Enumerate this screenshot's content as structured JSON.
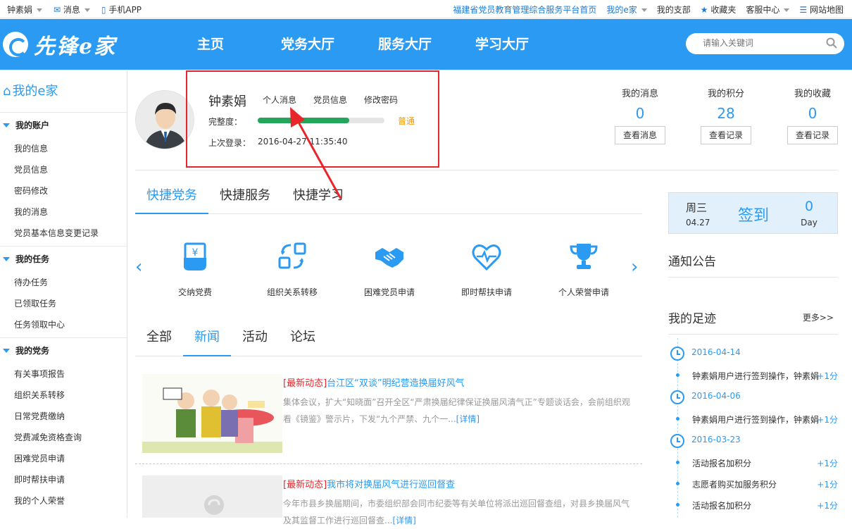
{
  "topbar": {
    "user": "钟素娟",
    "messages": "消息",
    "mobile_app": "手机APP",
    "portal_link": "福建省党员教育管理综合服务平台首页",
    "my_ejia": "我的e家",
    "my_branch": "我的支部",
    "favorites": "收藏夹",
    "service_center": "客服中心",
    "sitemap": "网站地图"
  },
  "header": {
    "logo_text": "先锋e家",
    "nav": [
      "主页",
      "党务大厅",
      "服务大厅",
      "学习大厅"
    ],
    "search_placeholder": "请输入关键词"
  },
  "sidebar": {
    "title": "我的e家",
    "sections": [
      {
        "title": "我的账户",
        "items": [
          "我的信息",
          "党员信息",
          "密码修改",
          "我的消息",
          "党员基本信息变更记录"
        ]
      },
      {
        "title": "我的任务",
        "items": [
          "待办任务",
          "已领取任务",
          "任务领取中心"
        ]
      },
      {
        "title": "我的党务",
        "items": [
          "有关事项报告",
          "组织关系转移",
          "日常党费缴纳",
          "党费减免资格查询",
          "困难党员申请",
          "即时帮扶申请",
          "我的个人荣誉"
        ]
      }
    ]
  },
  "profile": {
    "name": "钟素娟",
    "links": [
      "个人消息",
      "党员信息",
      "修改密码"
    ],
    "completeness_label": "完整度：",
    "completeness_percent": 72,
    "completeness_level": "普通",
    "last_login_label": "上次登录：",
    "last_login_value": "2016-04-27 11:35:40",
    "stats": [
      {
        "label": "我的消息",
        "value": "0",
        "button": "查看消息"
      },
      {
        "label": "我的积分",
        "value": "28",
        "button": "查看记录"
      },
      {
        "label": "我的收藏",
        "value": "0",
        "button": "查看记录"
      }
    ]
  },
  "quick": {
    "tabs": [
      "快捷党务",
      "快捷服务",
      "快捷学习"
    ],
    "active_tab": 0,
    "items": [
      {
        "label": "交纳党费",
        "icon": "payment-icon"
      },
      {
        "label": "组织关系转移",
        "icon": "transfer-icon"
      },
      {
        "label": "困难党员申请",
        "icon": "handshake-icon"
      },
      {
        "label": "即时帮扶申请",
        "icon": "heart-pulse-icon"
      },
      {
        "label": "个人荣誉申请",
        "icon": "trophy-icon"
      }
    ]
  },
  "news": {
    "tabs": [
      "全部",
      "新闻",
      "活动",
      "论坛"
    ],
    "active_tab": 1,
    "items": [
      {
        "tag": "[最新动态]",
        "title": "台江区“双谈”明纪营造换届好风气",
        "body": "集体会议，扩大“知晓面”召开全区“严肃换届纪律保证换届风清气正”专题谈话会，会前组织观看《镜鉴》警示片，下发“九个严禁、九个一...",
        "more": "[详情]"
      },
      {
        "tag": "[最新动态]",
        "title": "我市将对换届风气进行巡回督查",
        "body": "今年市县乡换届期间，市委组织部会同市纪委等有关单位将派出巡回督查组，对县乡换届风气及其监督工作进行巡回督查...",
        "more": "[详情]"
      }
    ]
  },
  "sign": {
    "weekday": "周三",
    "date": "04.27",
    "sign_label": "签到",
    "days": "0",
    "days_label": "Day"
  },
  "notice": {
    "title": "通知公告"
  },
  "footprint": {
    "title": "我的足迹",
    "more": "更多>>",
    "groups": [
      {
        "date": "2016-04-14",
        "items": [
          {
            "text": "钟素娟用户进行签到操作，钟素娟",
            "points": "+1分"
          }
        ]
      },
      {
        "date": "2016-04-06",
        "items": [
          {
            "text": "钟素娟用户进行签到操作，钟素娟",
            "points": "+1分"
          }
        ]
      },
      {
        "date": "2016-03-23",
        "items": [
          {
            "text": "活动报名加积分",
            "points": "+1分"
          },
          {
            "text": "志愿者购买加服务积分",
            "points": "+1分"
          },
          {
            "text": "活动报名加积分",
            "points": "+1分"
          }
        ]
      }
    ]
  },
  "colors": {
    "primary": "#2b9af3",
    "highlight": "#e8252b",
    "progress": "#23a55b",
    "level": "#f39800"
  }
}
